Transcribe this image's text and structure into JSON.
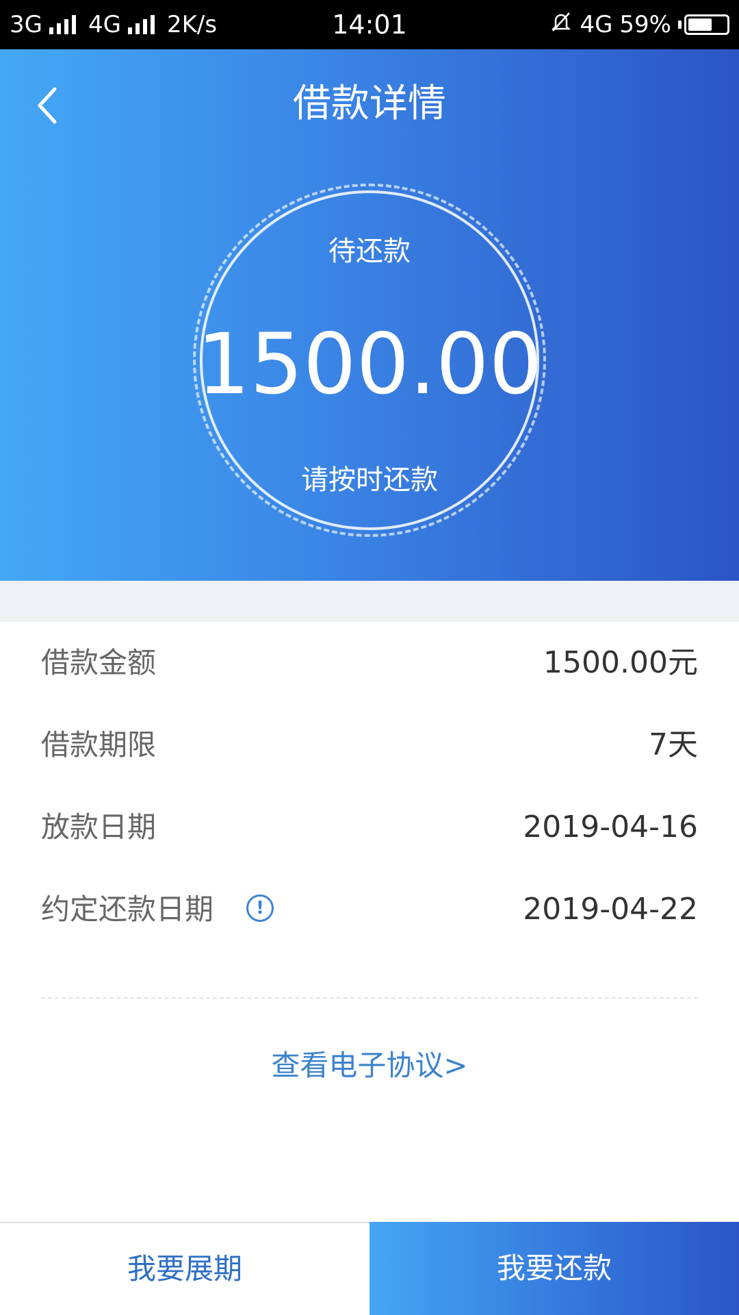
{
  "status_bar": {
    "network1": "3G",
    "network2": "4G",
    "speed": "2K/s",
    "time": "14:01",
    "network3": "4G",
    "battery_percent": "59%"
  },
  "header": {
    "title": "借款详情",
    "back_icon": "chevron-left-icon"
  },
  "summary": {
    "pending_label": "待还款",
    "amount": "1500.00",
    "reminder": "请按时还款"
  },
  "details": [
    {
      "label": "借款金额",
      "value": "1500.00元"
    },
    {
      "label": "借款期限",
      "value": "7天"
    },
    {
      "label": "放款日期",
      "value": "2019-04-16"
    },
    {
      "label": "约定还款日期",
      "value": "2019-04-22"
    }
  ],
  "info_icon": "!",
  "agreement_link": "查看电子协议>",
  "buttons": {
    "extend": "我要展期",
    "repay": "我要还款"
  },
  "colors": {
    "gradient_start": "#44a8f6",
    "gradient_end": "#2b55c4",
    "link": "#3b82cc"
  }
}
